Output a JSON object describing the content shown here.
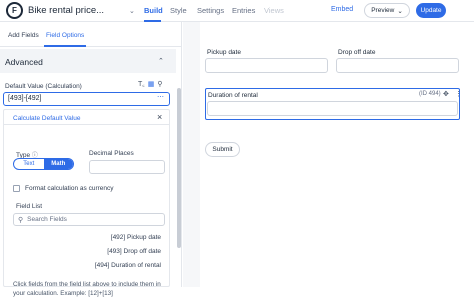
{
  "header": {
    "form_title": "Bike rental price...",
    "tabs": [
      {
        "label": "Build"
      },
      {
        "label": "Style"
      },
      {
        "label": "Settings"
      },
      {
        "label": "Entries"
      },
      {
        "label": "Views"
      }
    ],
    "embed_label": "Embed",
    "preview_label": "Preview",
    "update_label": "Update"
  },
  "sidebar": {
    "tabs": [
      {
        "label": "Add Fields"
      },
      {
        "label": "Field Options"
      }
    ],
    "section_title": "Advanced",
    "default_value_label": "Default Value",
    "default_value_mode": "(Calculation)",
    "default_value": "[493]-[492]",
    "calc_panel": {
      "title": "Calculate Default Value",
      "type_label": "Type",
      "type_options": [
        "Text",
        "Math"
      ],
      "type_selected": "Math",
      "decimal_places_label": "Decimal Places",
      "decimal_places_value": "",
      "currency_label": "Format calculation as currency",
      "currency_checked": false,
      "field_list_label": "Field List",
      "search_placeholder": "Search Fields",
      "fields": [
        {
          "text": "[492]  Pickup date"
        },
        {
          "text": "[493]  Drop off date"
        },
        {
          "text": "[494]  Duration of rental"
        }
      ],
      "help_text": "Click fields from the field list above to include them in your calculation. Example: [12]+[13]"
    }
  },
  "canvas": {
    "pickup_label": "Pickup date",
    "dropoff_label": "Drop off date",
    "duration_label": "Duration of rental",
    "duration_id": "(ID 494)",
    "submit_label": "Submit"
  },
  "colors": {
    "accent": "#2e6be6",
    "canvas_bg": "#f6f7f9",
    "border": "#d0d5dd"
  }
}
